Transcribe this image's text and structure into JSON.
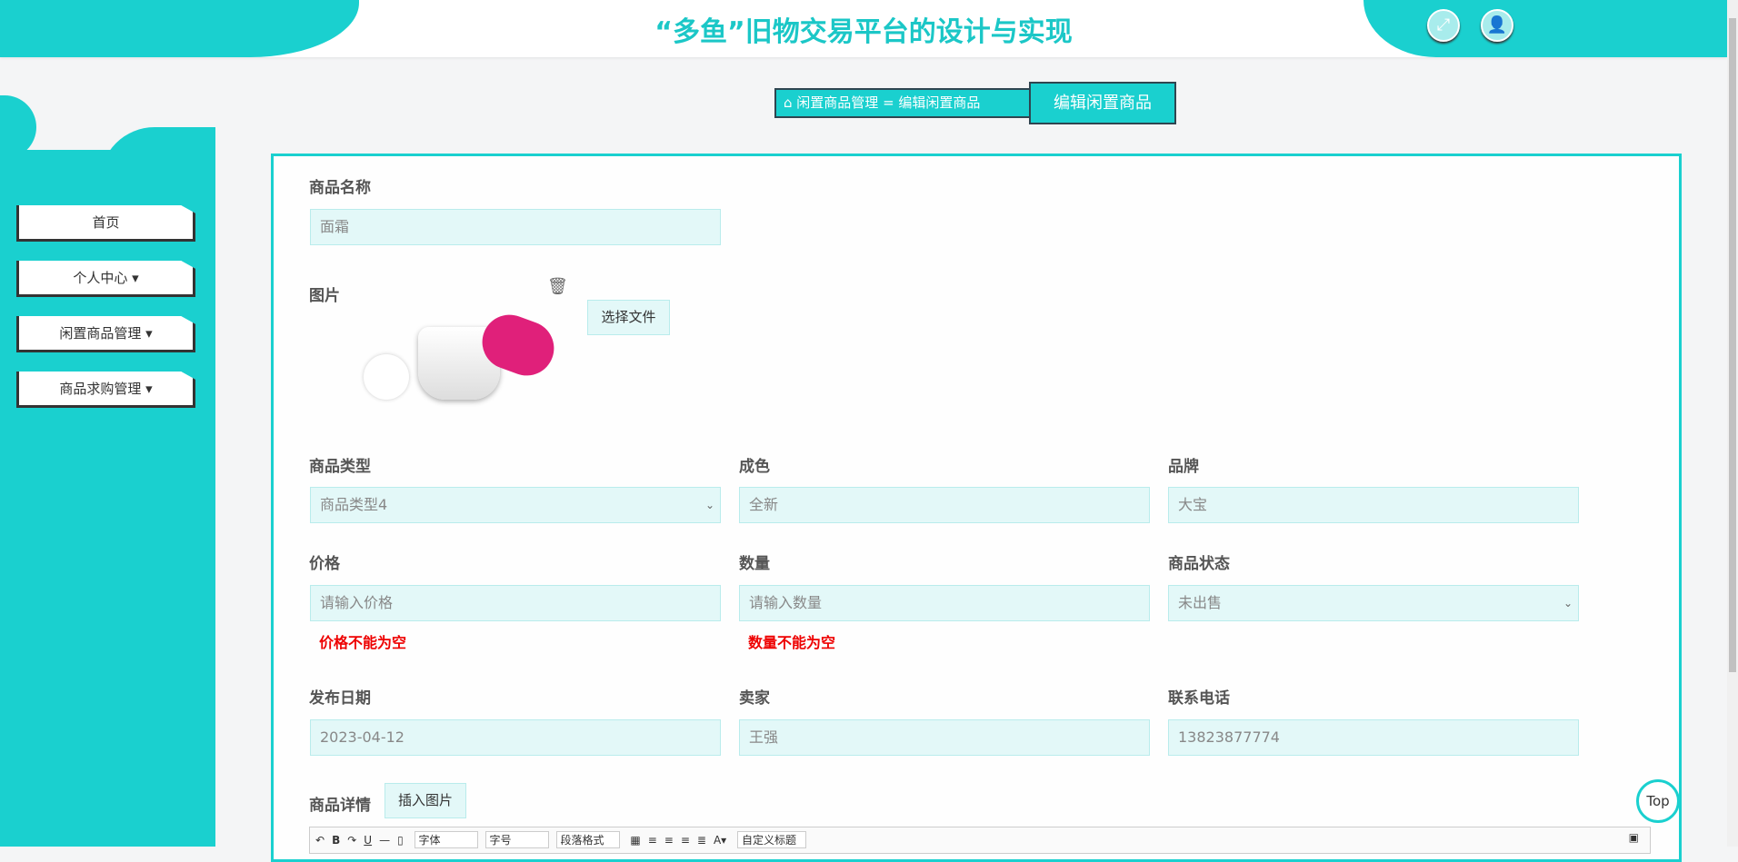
{
  "header": {
    "title": "“多鱼”旧物交易平台的设计与实现"
  },
  "sidebar": {
    "items": [
      {
        "label": "首页"
      },
      {
        "label": "个人中心 ▾"
      },
      {
        "label": "闲置商品管理 ▾"
      },
      {
        "label": "商品求购管理 ▾"
      }
    ]
  },
  "breadcrumb": {
    "path": "闲置商品管理 = 编辑闲置商品",
    "active": "编辑闲置商品"
  },
  "form": {
    "name": {
      "label": "商品名称",
      "value": "面霜"
    },
    "image": {
      "label": "图片",
      "choose_label": "选择文件"
    },
    "type": {
      "label": "商品类型",
      "value": "商品类型4"
    },
    "condition": {
      "label": "成色",
      "value": "全新"
    },
    "brand": {
      "label": "品牌",
      "value": "大宝"
    },
    "price": {
      "label": "价格",
      "placeholder": "请输入价格",
      "error": "价格不能为空"
    },
    "quantity": {
      "label": "数量",
      "placeholder": "请输入数量",
      "error": "数量不能为空"
    },
    "status": {
      "label": "商品状态",
      "value": "未出售"
    },
    "date": {
      "label": "发布日期",
      "value": "2023-04-12"
    },
    "seller": {
      "label": "卖家",
      "value": "王强"
    },
    "phone": {
      "label": "联系电话",
      "value": "13823877774"
    },
    "detail": {
      "label": "商品详情",
      "insert_label": "插入图片"
    }
  },
  "editor": {
    "font": "字体",
    "size": "字号",
    "paragraph": "段落格式",
    "custom_title": "自定义标题"
  },
  "top_label": "Top"
}
